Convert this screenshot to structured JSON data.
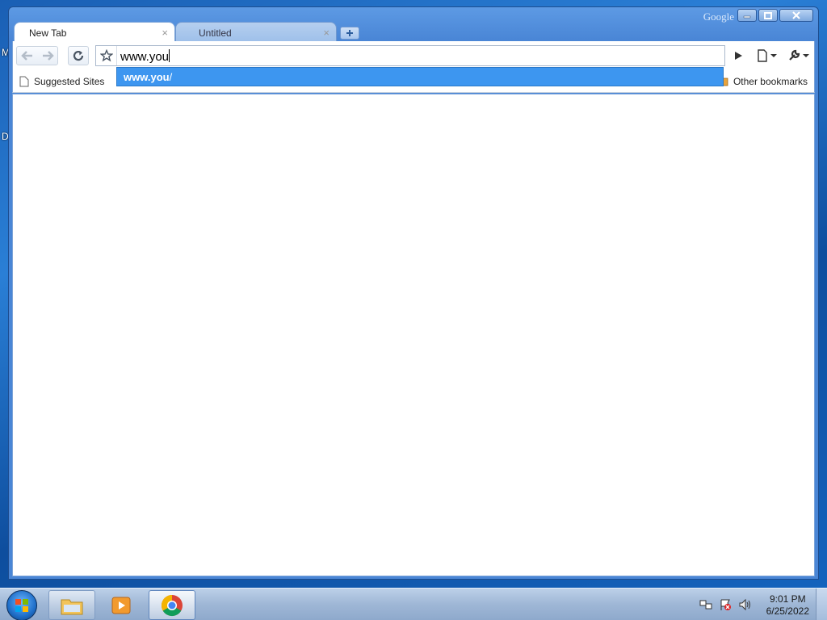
{
  "desktop": {
    "fragments": [
      "M",
      "D"
    ]
  },
  "window": {
    "brand_label": "Google",
    "controls": {
      "minimize": "minimize-icon",
      "maximize": "maximize-icon",
      "close": "close-icon"
    }
  },
  "tabs": [
    {
      "label": "New Tab",
      "active": true
    },
    {
      "label": "Untitled",
      "active": false
    }
  ],
  "tab_close_glyph": "×",
  "omnibox": {
    "value": "www.you"
  },
  "autocomplete": {
    "match_bold": "www.you",
    "match_rest": "/"
  },
  "bookmarks": {
    "suggested": "Suggested Sites",
    "other": "Other bookmarks"
  },
  "taskbar": {
    "clock_time": "9:01 PM",
    "clock_date": "6/25/2022"
  },
  "colors": {
    "accent": "#3d96f0",
    "window_frame": "#4a86d6"
  }
}
